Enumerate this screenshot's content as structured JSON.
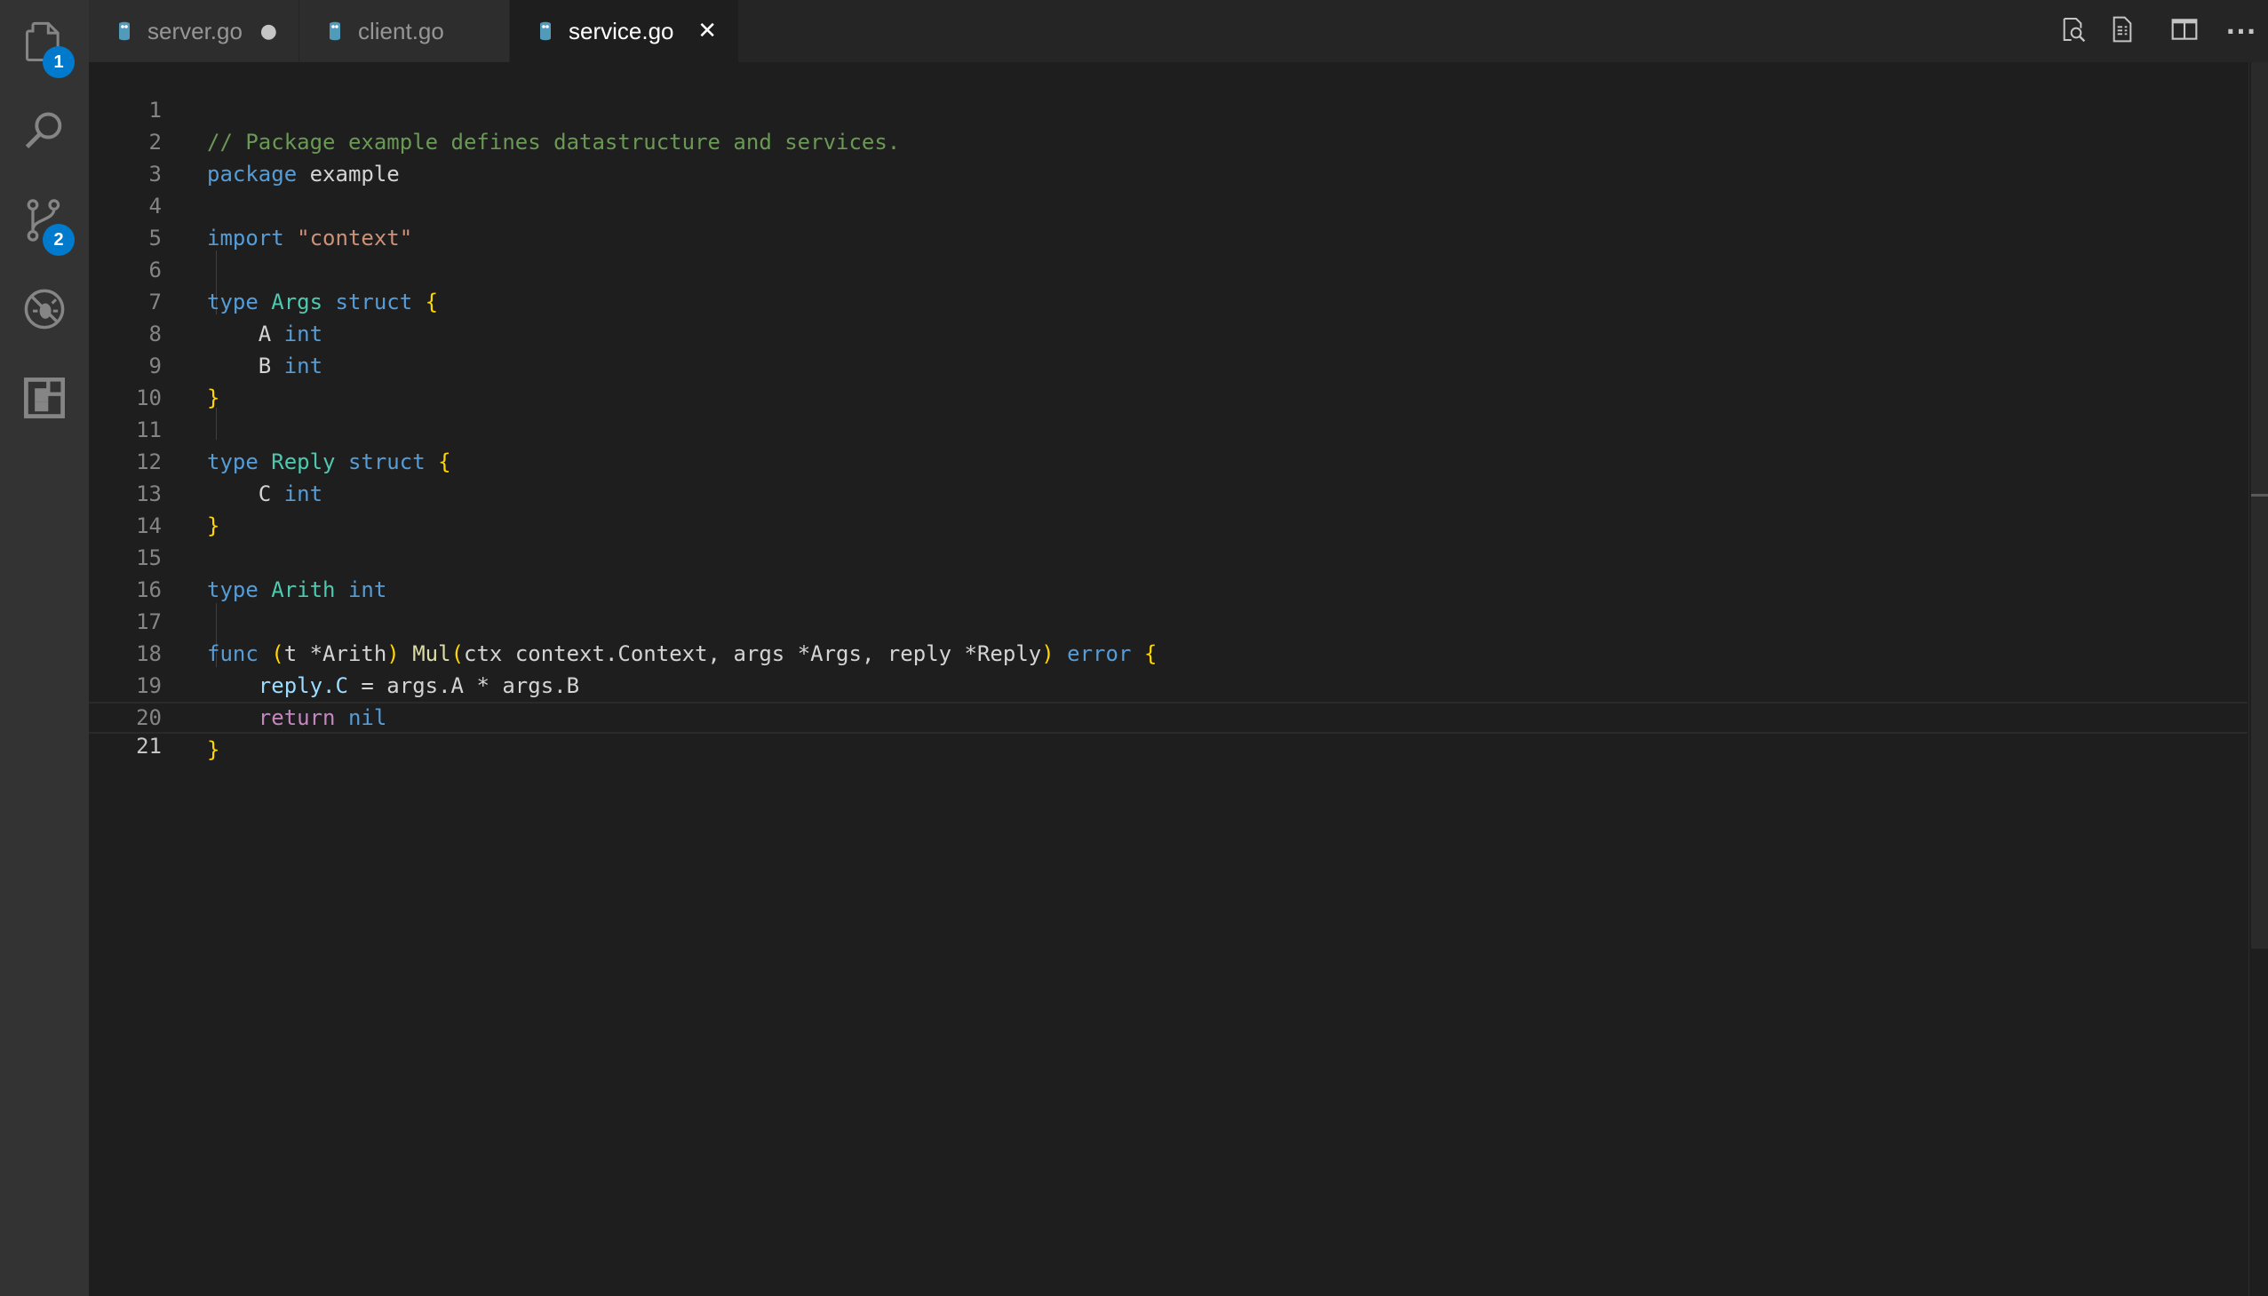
{
  "activity_bar": {
    "items": [
      {
        "icon": "files-icon",
        "badge": "1"
      },
      {
        "icon": "search-icon"
      },
      {
        "icon": "source-control-icon",
        "badge": "2"
      },
      {
        "icon": "debug-icon"
      },
      {
        "icon": "extensions-icon"
      }
    ],
    "badge_color": "#007acc"
  },
  "tabs": [
    {
      "label": "server.go",
      "icon": "go-file-icon",
      "state": "dirty",
      "action": "●"
    },
    {
      "label": "client.go",
      "icon": "go-file-icon",
      "state": "inactive",
      "action": ""
    },
    {
      "label": "service.go",
      "icon": "go-file-icon",
      "state": "active",
      "action": "✕"
    }
  ],
  "toolbar": {
    "icons": [
      "open-changes-icon",
      "open-preview-icon",
      "split-editor-icon",
      "more-actions-icon"
    ],
    "more_label": "···"
  },
  "editor": {
    "language": "go",
    "current_line": 21,
    "line_numbers": [
      "1",
      "2",
      "3",
      "4",
      "5",
      "6",
      "7",
      "8",
      "9",
      "10",
      "11",
      "12",
      "13",
      "14",
      "15",
      "16",
      "17",
      "18",
      "19",
      "20",
      "21"
    ],
    "lines": [
      "// Package example defines datastructure and services.",
      "package example",
      "",
      "import \"context\"",
      "",
      "type Args struct {",
      "    A int",
      "    B int",
      "}",
      "",
      "type Reply struct {",
      "    C int",
      "}",
      "",
      "type Arith int",
      "",
      "func (t *Arith) Mul(ctx context.Context, args *Args, reply *Reply) error {",
      "    reply.C = args.A * args.B",
      "    return nil",
      "}",
      ""
    ],
    "tokens": {
      "l1": [
        "// Package example defines datastructure and services."
      ],
      "l2": [
        "package",
        " example"
      ],
      "l4": [
        "import",
        " ",
        "\"context\""
      ],
      "l6": [
        "type",
        " ",
        "Args",
        " ",
        "struct",
        " ",
        "{"
      ],
      "l7": [
        "    ",
        "A",
        " ",
        "int"
      ],
      "l8": [
        "    ",
        "B",
        " ",
        "int"
      ],
      "l9": [
        "}"
      ],
      "l11": [
        "type",
        " ",
        "Reply",
        " ",
        "struct",
        " ",
        "{"
      ],
      "l12": [
        "    ",
        "C",
        " ",
        "int"
      ],
      "l13": [
        "}"
      ],
      "l15": [
        "type",
        " ",
        "Arith",
        " ",
        "int"
      ],
      "l17": [
        "func",
        " ",
        "(",
        "t *Arith",
        ")",
        " ",
        "Mul",
        "(",
        "ctx context.Context, args *Args, reply *Reply",
        ")",
        " ",
        "error",
        " ",
        "{"
      ],
      "l18": [
        "    ",
        "reply.C",
        " = args.A * args.B"
      ],
      "l19": [
        "    ",
        "return",
        " ",
        "nil"
      ],
      "l20": [
        "}"
      ]
    }
  },
  "colors": {
    "keyword": "#569cd6",
    "type": "#4ec9b0",
    "comment": "#6a9955",
    "string": "#ce9178",
    "function": "#dcdcaa",
    "control": "#c586c0",
    "bracket": "#ffd700",
    "variable": "#9cdcfe",
    "background": "#1e1e1e"
  }
}
